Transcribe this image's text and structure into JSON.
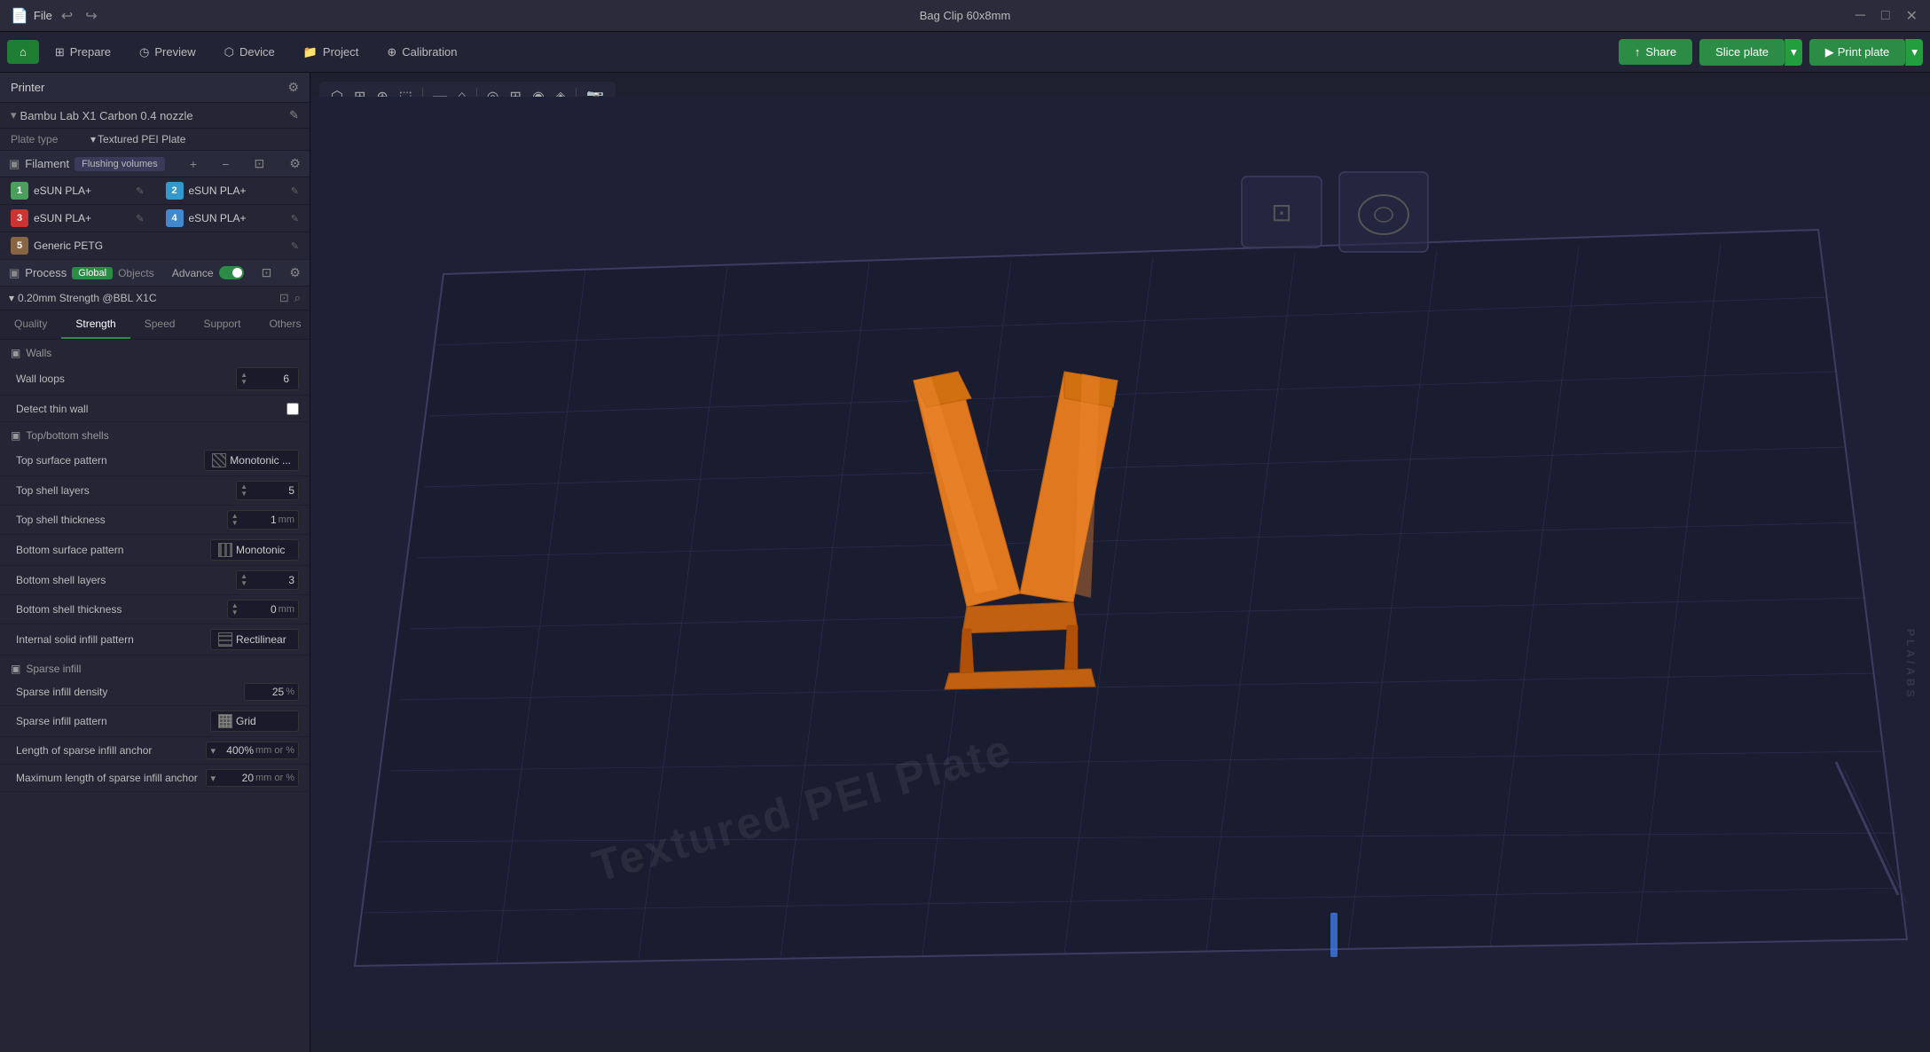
{
  "titlebar": {
    "file_label": "File",
    "title": "Bag Clip 60x8mm",
    "undo_icon": "↩",
    "redo_icon": "↪",
    "minimize_icon": "─",
    "maximize_icon": "□",
    "close_icon": "✕"
  },
  "navbar": {
    "prepare_label": "Prepare",
    "preview_label": "Preview",
    "device_label": "Device",
    "project_label": "Project",
    "calibration_label": "Calibration",
    "share_label": "Share",
    "slice_plate_label": "Slice plate",
    "print_plate_label": "Print plate"
  },
  "printer_section": {
    "label": "Printer",
    "printer_name": "Bambu Lab X1 Carbon 0.4 nozzle",
    "plate_type_label": "Plate type",
    "plate_type_value": "Textured PEI Plate"
  },
  "filament_section": {
    "label": "Filament",
    "flushing_label": "Flushing volumes",
    "items": [
      {
        "num": "1",
        "color": "#4a9f5c",
        "name": "eSUN PLA+"
      },
      {
        "num": "2",
        "color": "#3399cc",
        "name": "eSUN PLA+"
      },
      {
        "num": "3",
        "color": "#cc3333",
        "name": "eSUN PLA+"
      },
      {
        "num": "4",
        "color": "#4488cc",
        "name": "eSUN PLA+"
      },
      {
        "num": "5",
        "color": "#886644",
        "name": "Generic PETG"
      }
    ]
  },
  "process_section": {
    "label": "Process",
    "global_label": "Global",
    "objects_label": "Objects",
    "advance_label": "Advance",
    "profile_name": "0.20mm Strength @BBL X1C"
  },
  "tabs": [
    {
      "id": "quality",
      "label": "Quality"
    },
    {
      "id": "strength",
      "label": "Strength"
    },
    {
      "id": "speed",
      "label": "Speed"
    },
    {
      "id": "support",
      "label": "Support"
    },
    {
      "id": "others",
      "label": "Others"
    }
  ],
  "active_tab": "strength",
  "settings": {
    "walls_section": "Walls",
    "wall_loops_label": "Wall loops",
    "wall_loops_value": "6",
    "detect_thin_wall_label": "Detect thin wall",
    "top_bottom_section": "Top/bottom shells",
    "top_surface_pattern_label": "Top surface pattern",
    "top_surface_pattern_value": "Monotonic ...",
    "top_shell_layers_label": "Top shell layers",
    "top_shell_layers_value": "5",
    "top_shell_thickness_label": "Top shell thickness",
    "top_shell_thickness_value": "1",
    "top_shell_thickness_unit": "mm",
    "bottom_surface_pattern_label": "Bottom surface pattern",
    "bottom_surface_pattern_value": "Monotonic",
    "bottom_shell_layers_label": "Bottom shell layers",
    "bottom_shell_layers_value": "3",
    "bottom_shell_thickness_label": "Bottom shell thickness",
    "bottom_shell_thickness_value": "0",
    "bottom_shell_thickness_unit": "mm",
    "internal_solid_infill_label": "Internal solid infill pattern",
    "internal_solid_infill_value": "Rectilinear",
    "sparse_infill_section": "Sparse infill",
    "sparse_infill_density_label": "Sparse infill density",
    "sparse_infill_density_value": "25",
    "sparse_infill_density_unit": "%",
    "sparse_infill_pattern_label": "Sparse infill pattern",
    "sparse_infill_pattern_value": "Grid",
    "length_sparse_anchor_label": "Length of sparse infill anchor",
    "length_sparse_anchor_value": "400%",
    "length_sparse_anchor_unit": "mm or %",
    "max_length_sparse_label": "Maximum length of sparse infill anchor",
    "max_length_sparse_value": "20",
    "max_length_sparse_unit": "mm or %"
  },
  "viewport": {
    "plate_text": "Textured PEI Plate",
    "print_plate_label": "Print plate"
  }
}
